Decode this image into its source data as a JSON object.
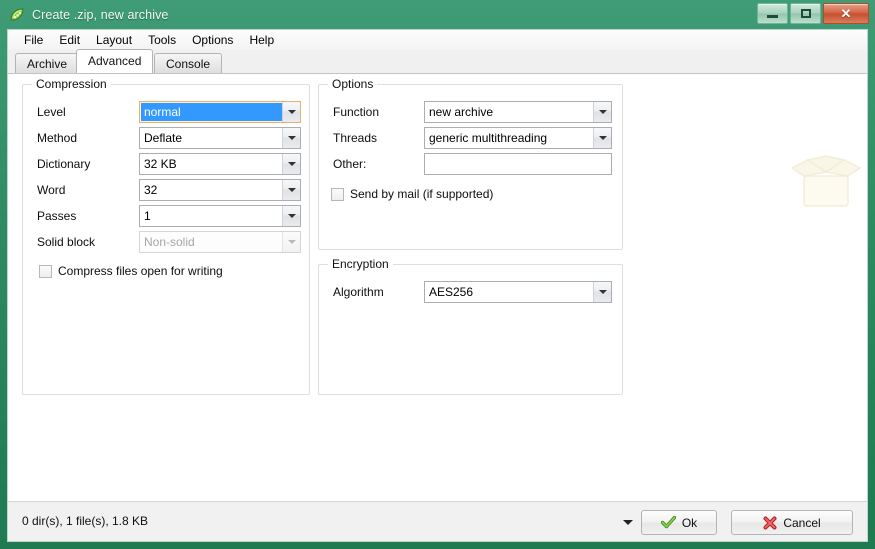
{
  "window": {
    "title": "Create .zip, new archive",
    "app_icon": "peazip-peapod-icon",
    "controls": {
      "minimize": "minimize-icon",
      "maximize": "maximize-icon",
      "close": "✕"
    },
    "frame_color": "#2e8b63"
  },
  "menubar": {
    "items": [
      {
        "label": "File"
      },
      {
        "label": "Edit"
      },
      {
        "label": "Layout"
      },
      {
        "label": "Tools"
      },
      {
        "label": "Options"
      },
      {
        "label": "Help"
      }
    ]
  },
  "tabs": [
    {
      "label": "Archive",
      "active": false
    },
    {
      "label": "Advanced",
      "active": true
    },
    {
      "label": "Console",
      "active": false
    }
  ],
  "compression": {
    "legend": "Compression",
    "fields": [
      {
        "label": "Level",
        "value": "normal",
        "state": "focused"
      },
      {
        "label": "Method",
        "value": "Deflate",
        "state": "normal"
      },
      {
        "label": "Dictionary",
        "value": "32 KB",
        "state": "normal"
      },
      {
        "label": "Word",
        "value": "32",
        "state": "normal"
      },
      {
        "label": "Passes",
        "value": "1",
        "state": "normal"
      },
      {
        "label": "Solid block",
        "value": "Non-solid",
        "state": "disabled"
      }
    ],
    "checkbox": {
      "label": "Compress files open for writing",
      "checked": false
    }
  },
  "options": {
    "legend": "Options",
    "fields": [
      {
        "label": "Function",
        "value": "new archive"
      },
      {
        "label": "Threads",
        "value": "generic multithreading"
      }
    ],
    "other": {
      "label": "Other:",
      "value": "",
      "placeholder": ""
    },
    "checkbox": {
      "label": "Send by mail (if supported)",
      "checked": false
    }
  },
  "encryption": {
    "legend": "Encryption",
    "algorithm": {
      "label": "Algorithm",
      "value": "AES256"
    }
  },
  "watermark": {
    "icon": "open-box-icon"
  },
  "statusbar": {
    "text": "0 dir(s), 1 file(s), 1.8 KB",
    "ok_button": {
      "label": "Ok",
      "icon": "green-check-icon"
    },
    "cancel_button": {
      "label": "Cancel",
      "icon": "red-x-icon"
    },
    "ok_dropdown": "chevron-down-icon"
  },
  "colors": {
    "accent_green": "#2e8b63",
    "selection_blue": "#3399ff",
    "focus_orange": "#e8b16a",
    "close_red": "#d4603f"
  }
}
